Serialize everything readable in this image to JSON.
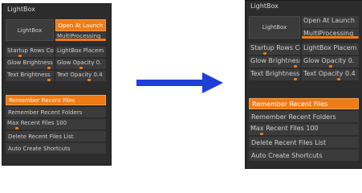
{
  "panels": [
    {
      "title": "LightBox",
      "lightbox_button": "LightBox",
      "open_at_launch": "Open At Launch",
      "multiprocessing": "MultiProcessing",
      "startup_rows": "Startup Rows Co",
      "lightbox_placement": "LightBox Placem",
      "glow_brightness": "Glow Brightness",
      "glow_opacity": "Glow Opacity 0.",
      "text_brightness": "Text Brightness",
      "text_opacity": "Text Opacity 0.4",
      "remember_recent_files": "Remember Recent Files",
      "remember_recent_folders": "Remember Recent Folders",
      "max_recent_files": "Max Recent Files 100",
      "delete_recent_files_list": "Delete Recent Files List",
      "auto_create_shortcuts": "Auto Create Shortcuts"
    },
    {
      "title": "LightBox",
      "lightbox_button": "LightBox",
      "open_at_launch": "Open At Launch",
      "multiprocessing": "MultiProcessing",
      "startup_rows": "Startup Rows Co",
      "lightbox_placement": "LightBox Placem",
      "glow_brightness": "Glow Brightness",
      "glow_opacity": "Glow Opacity 0.",
      "text_brightness": "Text Brightness",
      "text_opacity": "Text Opacity 0.4",
      "remember_recent_files": "Remember Recent Files",
      "remember_recent_folders": "Remember Recent Folders",
      "max_recent_files": "Max Recent Files 100",
      "delete_recent_files_list": "Delete Recent Files List",
      "auto_create_shortcuts": "Auto Create Shortcuts"
    }
  ],
  "colors": {
    "accent": "#f07a14",
    "panel_bg": "#2c2c2c",
    "control_bg": "#3b3b3b",
    "text": "#cfcfcf",
    "arrow": "#1e3fd8"
  },
  "arrow_icon": "arrow-right-icon"
}
